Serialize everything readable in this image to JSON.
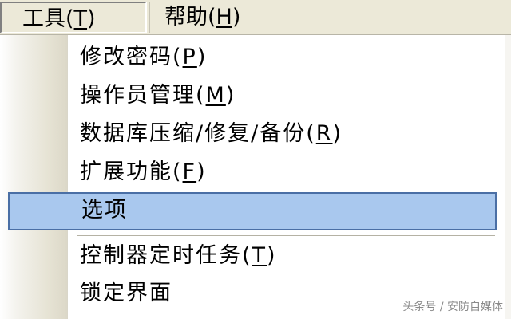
{
  "menubar": {
    "tools": {
      "text": "工具",
      "shortcut_open": "(",
      "shortcut_key": "T",
      "shortcut_close": ")"
    },
    "help": {
      "text": "帮助",
      "shortcut_open": "(",
      "shortcut_key": "H",
      "shortcut_close": ")"
    }
  },
  "menu": {
    "items": [
      {
        "text": "修改密码",
        "shortcut_open": "(",
        "shortcut_key": "P",
        "shortcut_close": ")"
      },
      {
        "text": "操作员管理",
        "shortcut_open": "(",
        "shortcut_key": "M",
        "shortcut_close": ")"
      },
      {
        "text": "数据库压缩/修复/备份",
        "shortcut_open": "(",
        "shortcut_key": "R",
        "shortcut_close": ")"
      },
      {
        "text": "扩展功能",
        "shortcut_open": "(",
        "shortcut_key": "F",
        "shortcut_close": ")"
      },
      {
        "text": "选项"
      },
      {
        "text": "控制器定时任务",
        "shortcut_open": "(",
        "shortcut_key": "T",
        "shortcut_close": ")"
      },
      {
        "text": "锁定界面"
      }
    ],
    "selected_index": 4
  },
  "watermark": "头条号 / 安防自媒体",
  "colors": {
    "menubar_bg": "#ece9d8",
    "selection_bg": "#a9c8ee",
    "selection_border": "#4a6fa5",
    "menu_bg": "#ffffff"
  }
}
